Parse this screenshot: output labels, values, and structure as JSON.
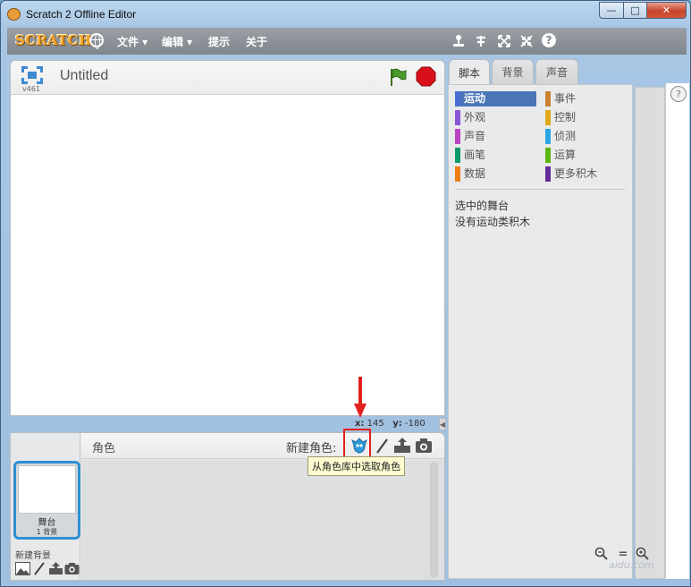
{
  "window": {
    "title": "Scratch 2 Offline Editor",
    "minimize": "—",
    "maximize": "□",
    "close": "✕"
  },
  "menubar": {
    "logo": "SCRATCH",
    "file": "文件 ▾",
    "edit": "编辑 ▾",
    "tips": "提示",
    "about": "关于"
  },
  "toolbar_icons": [
    "duplicate-icon",
    "delete-icon",
    "grow-icon",
    "shrink-icon",
    "help-icon"
  ],
  "stage": {
    "title": "Untitled",
    "version": "v461",
    "coords": {
      "x_label": "x:",
      "x": "145",
      "y_label": "y:",
      "y": "-180"
    }
  },
  "sprites": {
    "label": "角色",
    "new_sprite_label": "新建角色:",
    "tooltip": "从角色库中选取角色",
    "stage_name": "舞台",
    "stage_backdrops": "1 背景",
    "new_backdrop_label": "新建背景"
  },
  "tabs": [
    {
      "label": "脚本",
      "active": true
    },
    {
      "label": "背景",
      "active": false
    },
    {
      "label": "声音",
      "active": false
    }
  ],
  "categories": [
    {
      "label": "运动",
      "color": "#4a6cd4",
      "selected": true
    },
    {
      "label": "事件",
      "color": "#c88330"
    },
    {
      "label": "外观",
      "color": "#8a55d7"
    },
    {
      "label": "控制",
      "color": "#e1a91a"
    },
    {
      "label": "声音",
      "color": "#bb42c3"
    },
    {
      "label": "侦测",
      "color": "#2ca5e2"
    },
    {
      "label": "画笔",
      "color": "#0e9a6c"
    },
    {
      "label": "运算",
      "color": "#5cb712"
    },
    {
      "label": "数据",
      "color": "#ee7d16"
    },
    {
      "label": "更多积木",
      "color": "#632d99"
    }
  ],
  "palette": {
    "line1": "选中的舞台",
    "line2": "没有运动类积木"
  },
  "help": "?",
  "zoom": {
    "out": "−",
    "reset": "=",
    "in": "+"
  },
  "watermark": "aidu.com",
  "colors": {
    "accent": "#2e8fd3",
    "highlight": "#e2201c",
    "flag": "#4a9a2c",
    "stop": "#d9101a"
  }
}
